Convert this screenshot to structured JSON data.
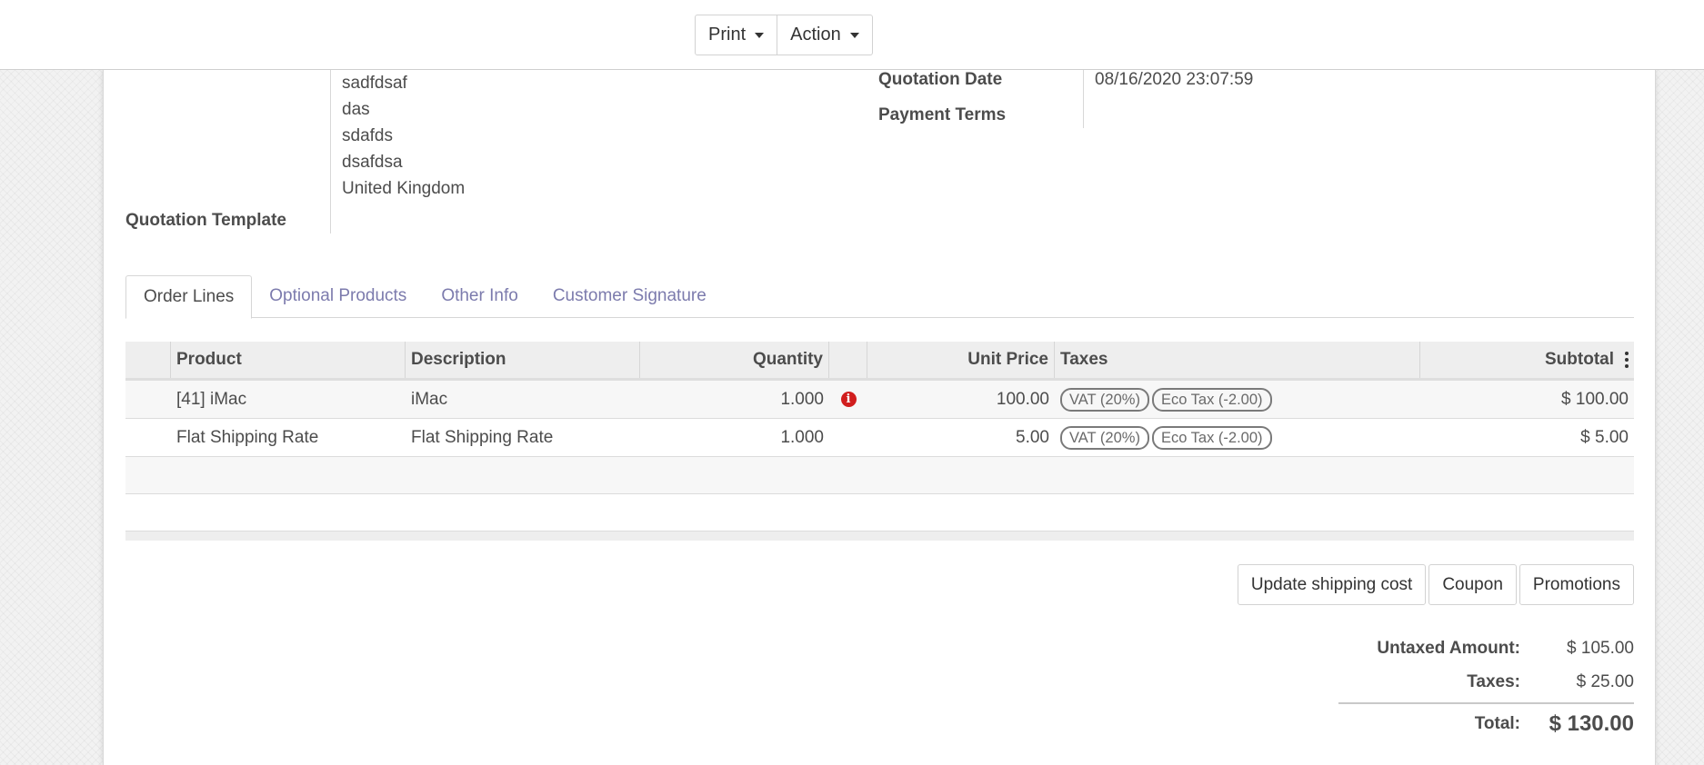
{
  "toolbar": {
    "print_label": "Print",
    "action_label": "Action"
  },
  "customer": {
    "address_lines": [
      "sadfdsaf",
      "das",
      "sdafds",
      "dsafdsa",
      "United Kingdom"
    ],
    "quotation_template_label": "Quotation Template"
  },
  "details": {
    "quotation_date_label": "Quotation Date",
    "quotation_date_value": "08/16/2020 23:07:59",
    "payment_terms_label": "Payment Terms"
  },
  "tabs": [
    "Order Lines",
    "Optional Products",
    "Other Info",
    "Customer Signature"
  ],
  "order_lines": {
    "columns": {
      "product": "Product",
      "description": "Description",
      "quantity": "Quantity",
      "unit_price": "Unit Price",
      "taxes": "Taxes",
      "subtotal": "Subtotal"
    },
    "rows": [
      {
        "product": "[41] iMac",
        "description": "iMac",
        "quantity": "1.000",
        "unit_price": "100.00",
        "taxes": [
          "VAT (20%)",
          "Eco Tax (-2.00)"
        ],
        "subtotal": "$ 100.00",
        "warning": "i"
      },
      {
        "product": "Flat Shipping Rate",
        "description": "Flat Shipping Rate",
        "quantity": "1.000",
        "unit_price": "5.00",
        "taxes": [
          "VAT (20%)",
          "Eco Tax (-2.00)"
        ],
        "subtotal": "$ 5.00"
      }
    ]
  },
  "actions": {
    "update_shipping": "Update shipping cost",
    "coupon": "Coupon",
    "promotions": "Promotions"
  },
  "totals": {
    "untaxed_label": "Untaxed Amount:",
    "untaxed_value": "$ 105.00",
    "taxes_label": "Taxes:",
    "taxes_value": "$ 25.00",
    "total_label": "Total:",
    "total_value": "$ 130.00"
  },
  "colors": {
    "link": "#7c7bad",
    "warning": "#d11e1e"
  }
}
